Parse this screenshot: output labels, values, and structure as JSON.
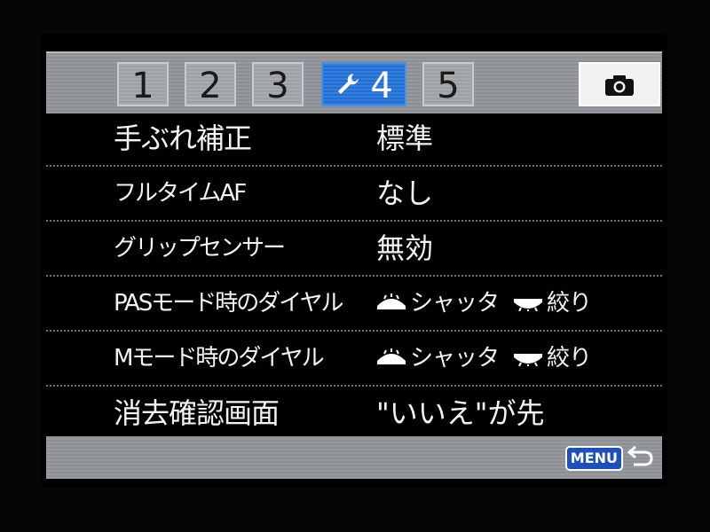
{
  "tabs": [
    {
      "label": "1",
      "active": false
    },
    {
      "label": "2",
      "active": false
    },
    {
      "label": "3",
      "active": false
    },
    {
      "label": "4",
      "icon": "wrench-icon",
      "active": true
    },
    {
      "label": "5",
      "active": false
    },
    {
      "label": "",
      "icon": "camera-icon",
      "active": false
    }
  ],
  "menu": {
    "items": [
      {
        "label": "手ぶれ補正",
        "value": "標準"
      },
      {
        "label": "フルタイムAF",
        "value": "なし"
      },
      {
        "label": "グリップセンサー",
        "value": "無効"
      },
      {
        "label": "PASモード時のダイヤル",
        "value_front": "シャッタ",
        "value_rear": "絞り",
        "front_icon": "front-dial-icon",
        "rear_icon": "rear-dial-icon"
      },
      {
        "label": "Mモード時のダイヤル",
        "value_front": "シャッタ",
        "value_rear": "絞り",
        "front_icon": "front-dial-icon",
        "rear_icon": "rear-dial-icon"
      },
      {
        "label": "消去確認画面",
        "value": "\"いいえ\"が先"
      }
    ]
  },
  "footer": {
    "menu_label": "MENU",
    "return_icon": "return-icon"
  },
  "colors": {
    "active_tab": "#1f6fd6",
    "bar_gray": "#8c8f93",
    "text": "#f4f4f4"
  }
}
